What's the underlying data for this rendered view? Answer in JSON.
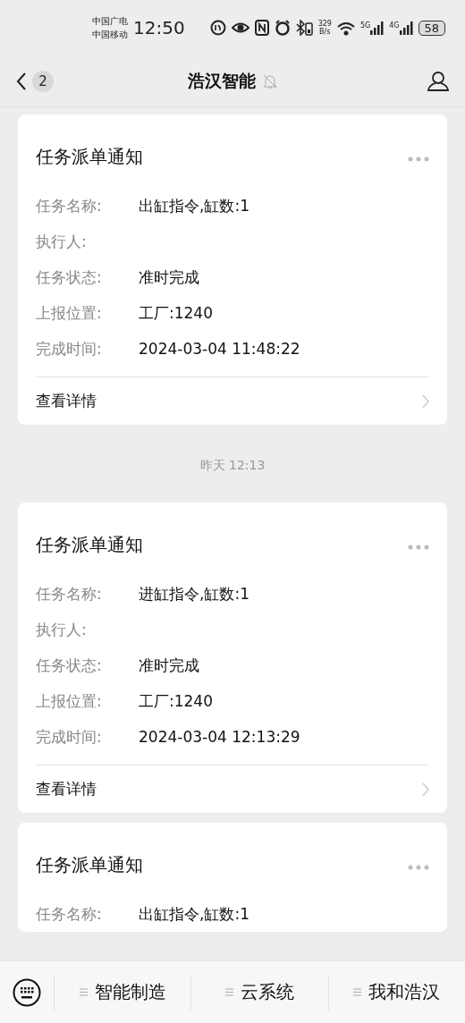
{
  "status_bar": {
    "carriers": [
      "中国广电",
      "中国移动"
    ],
    "time": "12:50",
    "speed": [
      "329",
      "B/s"
    ],
    "networks": [
      "5G",
      "4G"
    ],
    "battery": "58"
  },
  "nav": {
    "back_count": "2",
    "title": "浩汉智能"
  },
  "messages": [
    {
      "kind": "card",
      "title": "任务派单通知",
      "rows": [
        {
          "label": "任务名称:",
          "value": "出缸指令,缸数:1"
        },
        {
          "label": "执行人:"
        },
        {
          "label": "任务状态:",
          "value": "准时完成"
        },
        {
          "label": "上报位置:",
          "value": "工厂:1240"
        },
        {
          "label": "完成时间:",
          "value": "2024-03-04 11:48:22"
        }
      ],
      "link": "查看详情"
    },
    {
      "kind": "time",
      "text": "昨天 12:13"
    },
    {
      "kind": "card",
      "title": "任务派单通知",
      "rows": [
        {
          "label": "任务名称:",
          "value": "进缸指令,缸数:1"
        },
        {
          "label": "执行人:"
        },
        {
          "label": "任务状态:",
          "value": "准时完成"
        },
        {
          "label": "上报位置:",
          "value": "工厂:1240"
        },
        {
          "label": "完成时间:",
          "value": "2024-03-04 12:13:29"
        }
      ],
      "link": "查看详情"
    },
    {
      "kind": "card",
      "title": "任务派单通知",
      "rows": [
        {
          "label": "任务名称:",
          "value": "出缸指令,缸数:1"
        }
      ]
    }
  ],
  "menu": [
    "智能制造",
    "云系统",
    "我和浩汉"
  ]
}
